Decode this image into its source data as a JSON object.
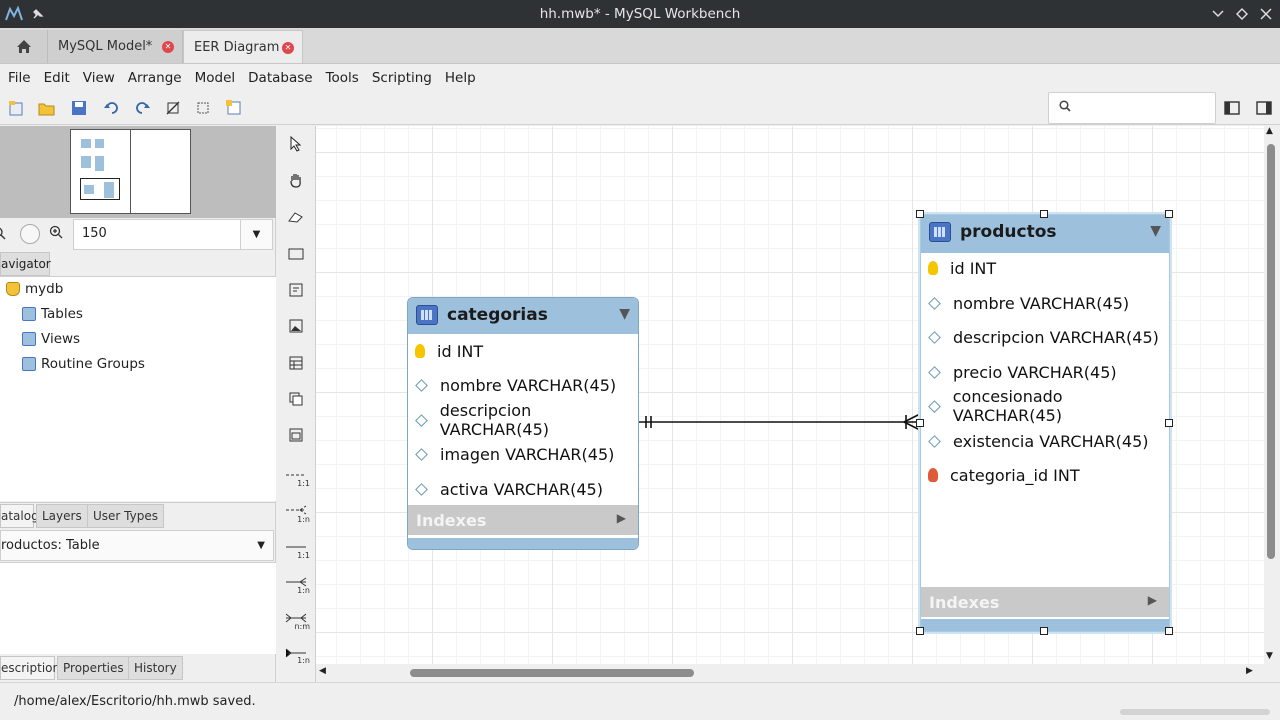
{
  "window": {
    "title": "hh.mwb* - MySQL Workbench"
  },
  "tabs": [
    {
      "label": "MySQL Model*"
    },
    {
      "label": "EER Diagram"
    }
  ],
  "menu": [
    "File",
    "Edit",
    "View",
    "Arrange",
    "Model",
    "Database",
    "Tools",
    "Scripting",
    "Help"
  ],
  "zoom": {
    "value": "150"
  },
  "navigator": {
    "tab_label": "avigator"
  },
  "tree": {
    "root": "mydb",
    "children": [
      "Tables",
      "Views",
      "Routine Groups"
    ]
  },
  "catalog_tabs": [
    "atalog",
    "Layers",
    "User Types"
  ],
  "object_selector": {
    "value": "roductos: Table"
  },
  "desc_tabs": [
    "escription",
    "Properties",
    "History"
  ],
  "relationship_labels": [
    "1:1",
    "1:n",
    "1:1",
    "1:n",
    "n:m",
    "1:n"
  ],
  "entities": [
    {
      "name": "categorias",
      "columns": [
        {
          "name": "id INT",
          "kind": "pk"
        },
        {
          "name": "nombre VARCHAR(45)",
          "kind": "col"
        },
        {
          "name": "descripcion VARCHAR(45)",
          "kind": "col"
        },
        {
          "name": "imagen VARCHAR(45)",
          "kind": "col"
        },
        {
          "name": "activa VARCHAR(45)",
          "kind": "col"
        }
      ],
      "indexes_label": "Indexes"
    },
    {
      "name": "productos",
      "columns": [
        {
          "name": "id INT",
          "kind": "pk"
        },
        {
          "name": "nombre VARCHAR(45)",
          "kind": "col"
        },
        {
          "name": "descripcion VARCHAR(45)",
          "kind": "col"
        },
        {
          "name": "precio VARCHAR(45)",
          "kind": "col"
        },
        {
          "name": "concesionado VARCHAR(45)",
          "kind": "col"
        },
        {
          "name": "existencia VARCHAR(45)",
          "kind": "col"
        },
        {
          "name": "categoria_id INT",
          "kind": "fk"
        }
      ],
      "indexes_label": "Indexes"
    }
  ],
  "status": {
    "message": "/home/alex/Escritorio/hh.mwb saved."
  },
  "colors": {
    "entity_header": "#9dc0dc",
    "title_bar": "#2f3234",
    "close_badge": "#e0474c"
  }
}
